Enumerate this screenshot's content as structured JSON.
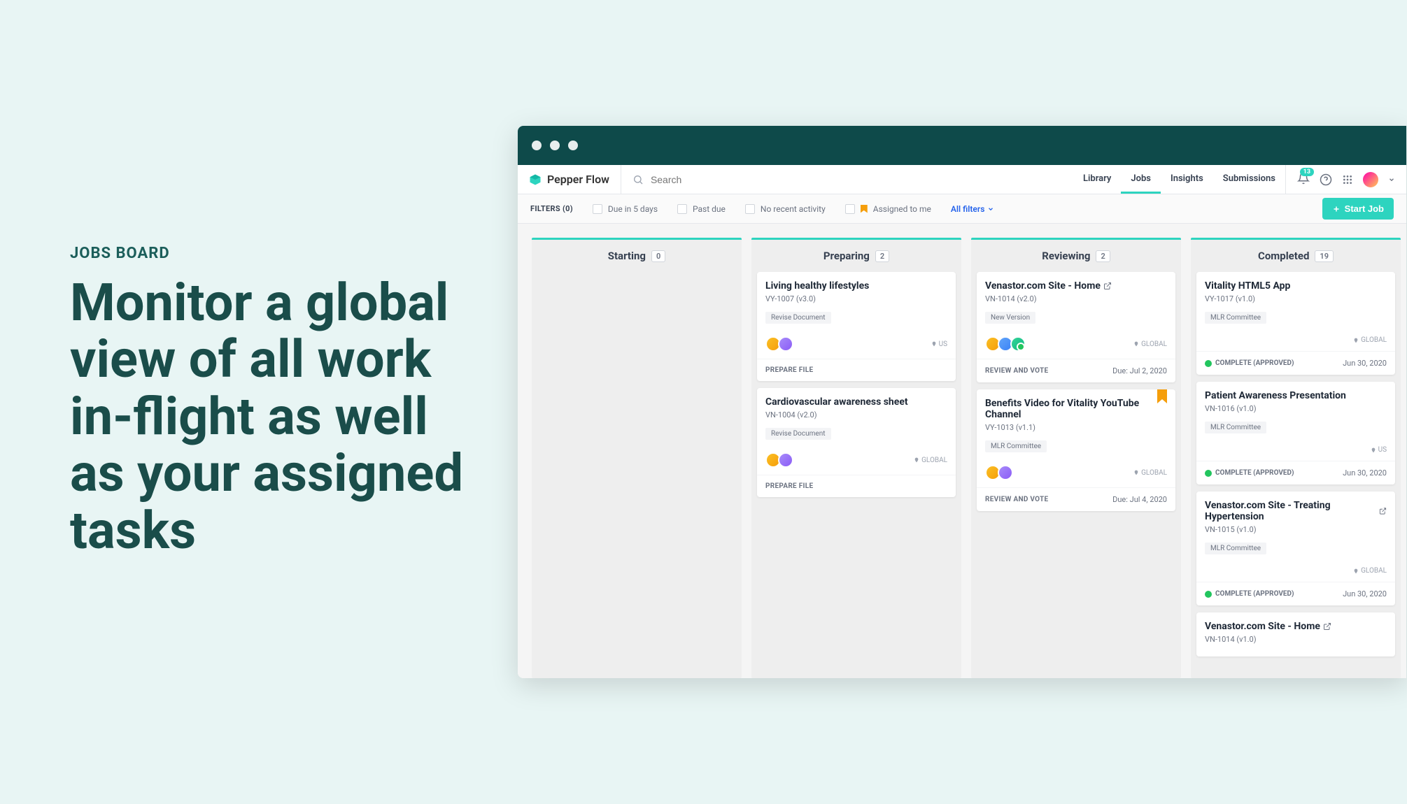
{
  "marketing": {
    "eyebrow": "JOBS BOARD",
    "headline": "Monitor a global view of all work in-flight as well as your assigned tasks"
  },
  "app": {
    "brand": "Pepper Flow",
    "search_placeholder": "Search",
    "nav": [
      "Library",
      "Jobs",
      "Insights",
      "Submissions"
    ],
    "notification_count": "13",
    "start_job_label": "Start Job"
  },
  "filters": {
    "label": "FILTERS (0)",
    "options": [
      "Due in 5 days",
      "Past due",
      "No recent activity",
      "Assigned to me"
    ],
    "all_label": "All filters"
  },
  "columns": [
    {
      "title": "Starting",
      "count": "0",
      "cards": []
    },
    {
      "title": "Preparing",
      "count": "2",
      "cards": [
        {
          "title": "Living healthy lifestyles",
          "sub": "VY-1007 (v3.0)",
          "tag": "Revise Document",
          "loc": "US",
          "foot_action": "PREPARE FILE",
          "avatars": [
            "av1",
            "av2"
          ]
        },
        {
          "title": "Cardiovascular awareness sheet",
          "sub": "VN-1004 (v2.0)",
          "tag": "Revise Document",
          "loc": "GLOBAL",
          "foot_action": "PREPARE FILE",
          "avatars": [
            "av1",
            "av2"
          ]
        }
      ]
    },
    {
      "title": "Reviewing",
      "count": "2",
      "cards": [
        {
          "title": "Venastor.com Site - Home",
          "ext": true,
          "sub": "VN-1014 (v2.0)",
          "tag": "New Version",
          "loc": "GLOBAL",
          "foot_action": "REVIEW AND VOTE",
          "due": "Due: Jul 2, 2020",
          "avatars": [
            "av1",
            "av3",
            "av4"
          ]
        },
        {
          "title": "Benefits Video for Vitality YouTube Channel",
          "bookmark": true,
          "sub": "VY-1013 (v1.1)",
          "tag": "MLR Committee",
          "loc": "GLOBAL",
          "foot_action": "REVIEW AND VOTE",
          "due": "Due: Jul 4, 2020",
          "avatars": [
            "av1",
            "av2"
          ]
        }
      ]
    },
    {
      "title": "Completed",
      "count": "19",
      "cards": [
        {
          "title": "Vitality HTML5 App",
          "sub": "VY-1017 (v1.0)",
          "tag": "MLR Committee",
          "loc": "GLOBAL",
          "status": "COMPLETE (APPROVED)",
          "date": "Jun 30, 2020"
        },
        {
          "title": "Patient Awareness Presentation",
          "sub": "VN-1016 (v1.0)",
          "tag": "MLR Committee",
          "loc": "US",
          "status": "COMPLETE (APPROVED)",
          "date": "Jun 30, 2020"
        },
        {
          "title": "Venastor.com Site - Treating Hypertension",
          "ext": true,
          "sub": "VN-1015 (v1.0)",
          "tag": "MLR Committee",
          "loc": "GLOBAL",
          "status": "COMPLETE (APPROVED)",
          "date": "Jun 30, 2020"
        },
        {
          "title": "Venastor.com Site - Home",
          "ext": true,
          "sub": "VN-1014 (v1.0)"
        }
      ]
    }
  ]
}
